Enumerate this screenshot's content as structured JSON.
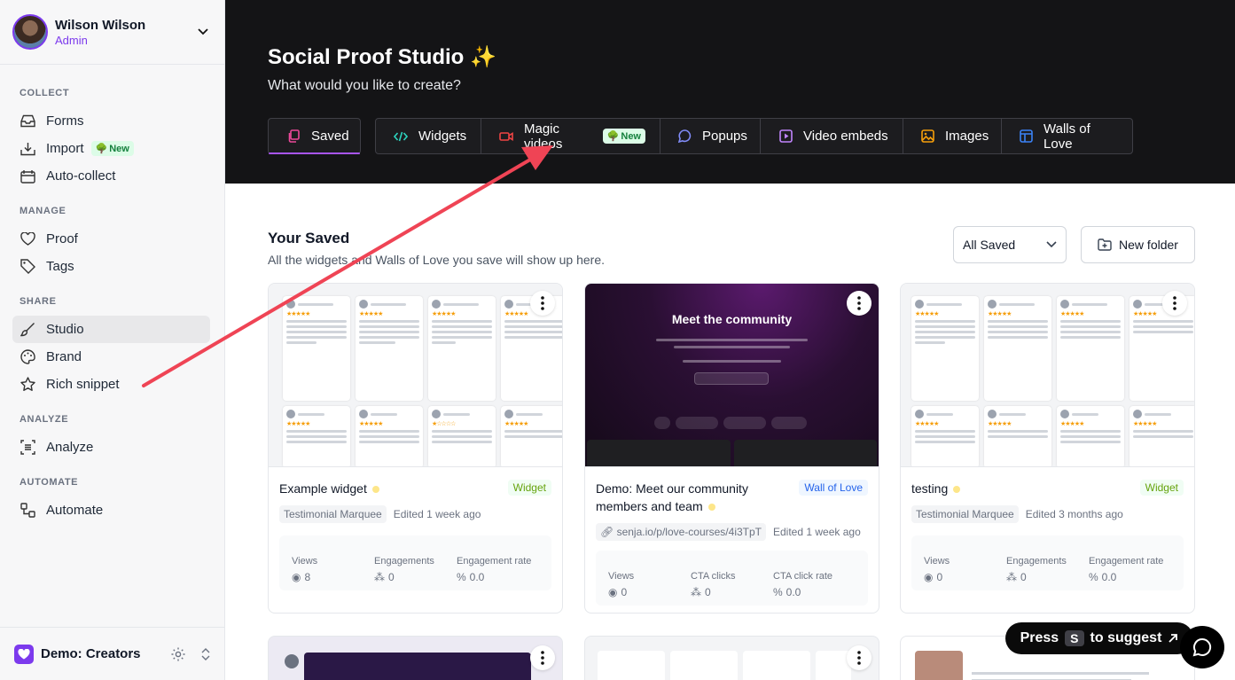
{
  "user": {
    "name": "Wilson Wilson",
    "role": "Admin"
  },
  "sidebar": {
    "sections": [
      {
        "label": "COLLECT",
        "items": [
          {
            "label": "Forms"
          },
          {
            "label": "Import",
            "badge": "New"
          },
          {
            "label": "Auto-collect"
          }
        ]
      },
      {
        "label": "MANAGE",
        "items": [
          {
            "label": "Proof"
          },
          {
            "label": "Tags"
          }
        ]
      },
      {
        "label": "SHARE",
        "items": [
          {
            "label": "Studio",
            "active": true
          },
          {
            "label": "Brand"
          },
          {
            "label": "Rich snippet"
          }
        ]
      },
      {
        "label": "ANALYZE",
        "items": [
          {
            "label": "Analyze"
          }
        ]
      },
      {
        "label": "AUTOMATE",
        "items": [
          {
            "label": "Automate"
          }
        ]
      }
    ],
    "workspace": "Demo: Creators"
  },
  "header": {
    "title": "Social Proof Studio ✨",
    "subtitle": "What would you like to create?",
    "saved_tab": "Saved",
    "tabs": [
      {
        "label": "Widgets"
      },
      {
        "label": "Magic videos",
        "badge": "New"
      },
      {
        "label": "Popups"
      },
      {
        "label": "Video embeds"
      },
      {
        "label": "Images"
      },
      {
        "label": "Walls of Love"
      }
    ]
  },
  "main": {
    "title": "Your Saved",
    "subtitle": "All the widgets and Walls of Love you save will show up here.",
    "filter": "All Saved",
    "new_folder": "New folder"
  },
  "cards": [
    {
      "title": "Example widget",
      "type": "Widget",
      "chip": "Testimonial Marquee",
      "edited": "Edited 1 week ago",
      "stats": [
        {
          "label": "Views",
          "value": "8"
        },
        {
          "label": "Engagements",
          "value": "0"
        },
        {
          "label": "Engagement rate",
          "value": "0.0"
        }
      ]
    },
    {
      "title": "Demo: Meet our community members and team",
      "type": "Wall of Love",
      "chip": "senja.io/p/love-courses/4i3TpT",
      "edited": "Edited 1 week ago",
      "preview_title": "Meet the community",
      "stats": [
        {
          "label": "Views",
          "value": "0"
        },
        {
          "label": "CTA clicks",
          "value": "0"
        },
        {
          "label": "CTA click rate",
          "value": "0.0"
        }
      ]
    },
    {
      "title": "testing",
      "type": "Widget",
      "chip": "Testimonial Marquee",
      "edited": "Edited 3 months ago",
      "stats": [
        {
          "label": "Views",
          "value": "0"
        },
        {
          "label": "Engagements",
          "value": "0"
        },
        {
          "label": "Engagement rate",
          "value": "0.0"
        }
      ]
    }
  ],
  "suggest": {
    "press": "Press",
    "key": "S",
    "rest": "to suggest"
  },
  "colors": {
    "accent": "#7c3aed",
    "arrow": "#ef4455",
    "header_bg": "#141416"
  }
}
